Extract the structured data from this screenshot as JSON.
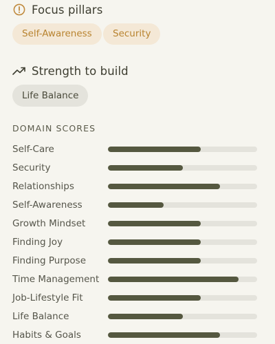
{
  "focus": {
    "title": "Focus pillars",
    "pillars": [
      "Self-Awareness",
      "Security"
    ]
  },
  "strength": {
    "title": "Strength to build",
    "items": [
      "Life Balance"
    ]
  },
  "domains": {
    "heading": "DOMAIN SCORES",
    "rows": [
      {
        "label": "Self-Care",
        "fraction": 0.62
      },
      {
        "label": "Security",
        "fraction": 0.5
      },
      {
        "label": "Relationships",
        "fraction": 0.75
      },
      {
        "label": "Self-Awareness",
        "fraction": 0.375
      },
      {
        "label": "Growth Mindset",
        "fraction": 0.62
      },
      {
        "label": "Finding Joy",
        "fraction": 0.62
      },
      {
        "label": "Finding Purpose",
        "fraction": 0.62
      },
      {
        "label": "Time Management",
        "fraction": 0.875
      },
      {
        "label": "Job-Lifestyle Fit",
        "fraction": 0.62
      },
      {
        "label": "Life Balance",
        "fraction": 0.5
      },
      {
        "label": "Habits & Goals",
        "fraction": 0.75
      }
    ]
  },
  "colors": {
    "background": "#f6f5ef",
    "pillar_chip_bg": "#f4e8d6",
    "pillar_chip_text": "#b8832f",
    "strength_chip_bg": "#e4e3dc",
    "bar_track": "#e4e3dc",
    "bar_fill": "#555840",
    "alert_icon": "#c08a3e"
  },
  "icons": {
    "focus": "alert-circle-icon",
    "strength": "trending-up-icon"
  }
}
